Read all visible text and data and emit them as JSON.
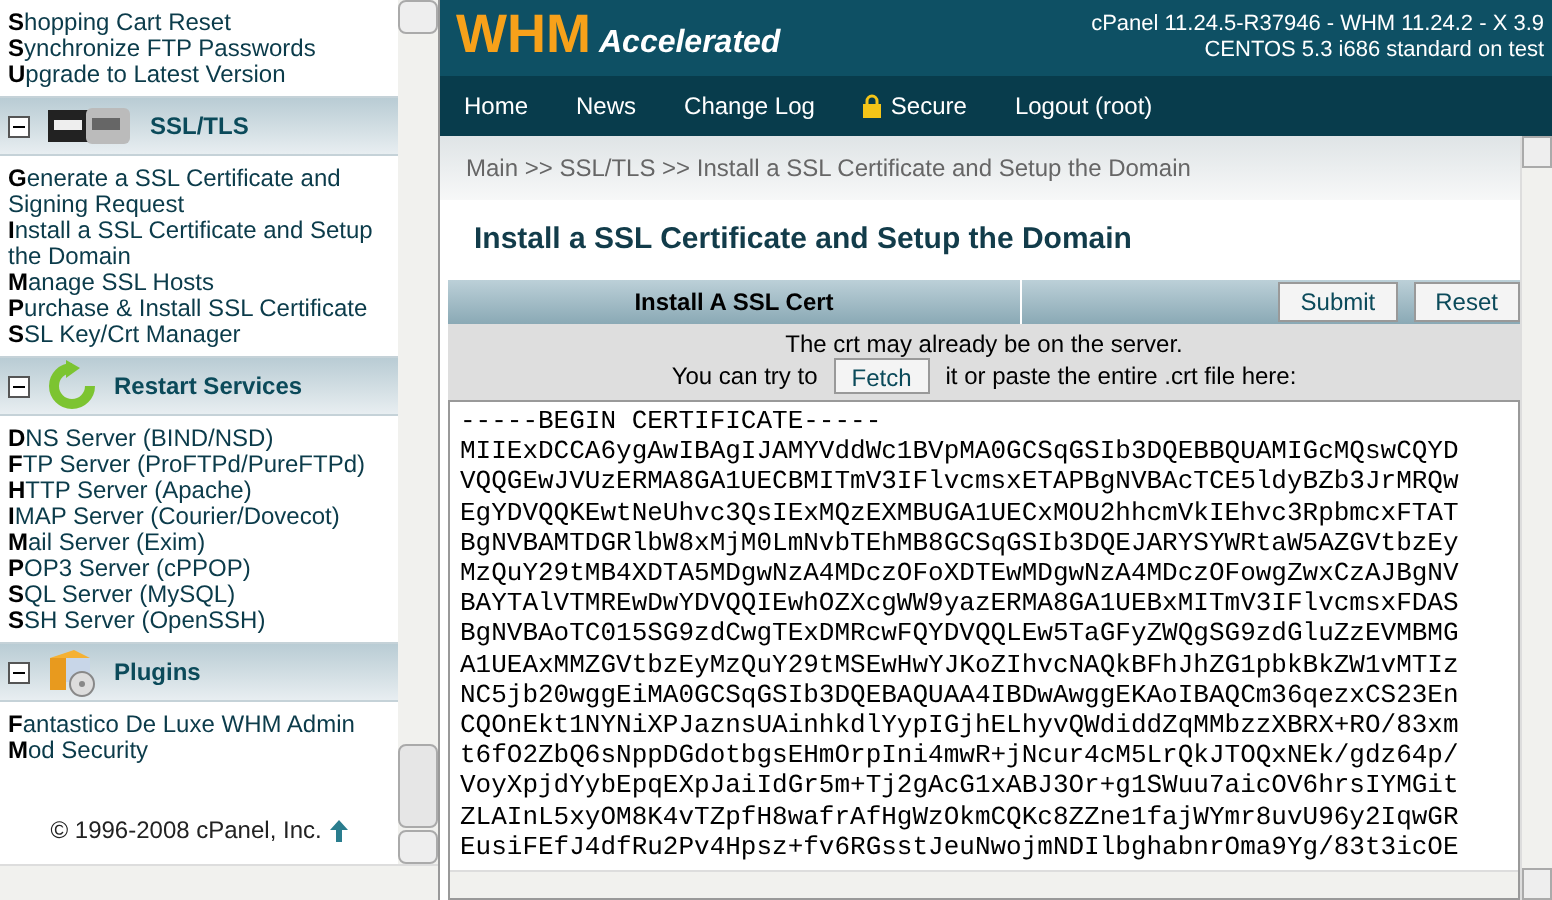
{
  "sidebar": {
    "groups": [
      {
        "items": [
          "**S**hopping Cart Reset",
          "**S**ynchronize FTP Passwords",
          "**U**pgrade to Latest Version"
        ]
      },
      {
        "title": "SSL/TLS",
        "kind": "modssl",
        "expanded": true,
        "items": [
          "**G**enerate a SSL Certificate and Signing Request",
          "**I**nstall a SSL Certificate and Setup the Domain",
          "**M**anage SSL Hosts",
          "**P**urchase & Install SSL Certificate",
          "**S**SL Key/Crt Manager"
        ]
      },
      {
        "title": "Restart Services",
        "kind": "restart",
        "expanded": true,
        "items": [
          "**D**NS Server (BIND/NSD)",
          "**F**TP Server (ProFTPd/PureFTPd)",
          "**H**TTP Server (Apache)",
          "**I**MAP Server (Courier/Dovecot)",
          "**M**ail Server (Exim)",
          "**P**OP3 Server (cPPOP)",
          "**S**QL Server (MySQL)",
          "**S**SH Server (OpenSSH)"
        ]
      },
      {
        "title": "Plugins",
        "kind": "plugins",
        "expanded": true,
        "items": [
          "**F**antastico De Luxe WHM Admin",
          "**M**od Security"
        ]
      }
    ],
    "footer": "© 1996-2008 cPanel, Inc."
  },
  "header": {
    "logo_main": "WHM",
    "logo_sub": "Accelerated",
    "version_line": "cPanel 11.24.5-R37946 - WHM 11.24.2 - X 3.9",
    "os_line": "CENTOS 5.3 i686 standard on test"
  },
  "nav": [
    {
      "label": "Home"
    },
    {
      "label": "News"
    },
    {
      "label": "Change Log"
    },
    {
      "label": "Secure",
      "kind": "secure"
    },
    {
      "label": "Logout (root)"
    }
  ],
  "breadcrumb": "Main >> SSL/TLS >> Install a SSL Certificate and Setup the Domain",
  "page_title": "Install a SSL Certificate and Setup the Domain",
  "form": {
    "heading": "Install A SSL Cert",
    "buttons": [
      "Submit",
      "Reset"
    ],
    "note": "The crt may already be on the server.",
    "fetch_prefix": "You can try to",
    "fetch_button": "Fetch",
    "fetch_suffix": "it or paste the entire .crt file here:",
    "certificate": [
      "-----BEGIN CERTIFICATE-----",
      "MIIExDCCA6ygAwIBAgIJAMYVddWc1BVpMA0GCSqGSIb3DQEBBQUAMIGcMQswCQYD",
      "VQQGEwJVUzERMA8GA1UECBMITmV3IFlvcmsxETAPBgNVBAcTCE5ldyBZb3JrMRQw",
      "EgYDVQQKEwtNeUhvc3QsIExMQzEXMBUGA1UECxMOU2hhcmVkIEhvc3RpbmcxFTAT",
      "BgNVBAMTDGRlbW8xMjM0LmNvbTEhMB8GCSqGSIb3DQEJARYSYWRtaW5AZGVtbzEy",
      "MzQuY29tMB4XDTA5MDgwNzA4MDczOFoXDTEwMDgwNzA4MDczOFowgZwxCzAJBgNV",
      "BAYTAlVTMREwDwYDVQQIEwhOZXcgWW9yazERMA8GA1UEBxMITmV3IFlvcmsxFDAS",
      "BgNVBAoTC015SG9zdCwgTExDMRcwFQYDVQQLEw5TaGFyZWQgSG9zdGluZzEVMBMG",
      "A1UEAxMMZGVtbzEyMzQuY29tMSEwHwYJKoZIhvcNAQkBFhJhZG1pbkBkZW1vMTIz",
      "NC5jb20wggEiMA0GCSqGSIb3DQEBAQUAA4IBDwAwggEKAoIBAQCm36qezxCS23En",
      "CQOnEkt1NYNiXPJaznsUAinhkdlYypIGjhELhyvQWdiddZqMMbzzXBRX+RO/83xm",
      "t6fO2ZbQ6sNppDGdotbgsEHmOrpIni4mwR+jNcur4cM5LrQkJTOQxNEk/gdz64p/",
      "VoyXpjdYybEpqEXpJaiIdGr5m+Tj2gAcG1xABJ3Or+g1SWuu7aicOV6hrsIYMGit",
      "ZLAInL5xyOM8K4vTZpfH8wafrAfHgWzOkmCQKc8ZZne1fajWYmr8uvU96y2IqwGR",
      "EusiFEfJ4dfRu2Pv4Hpsz+fv6RGsstJeuNwojmNDIlbghabnrOma9Yg/83t3icOE"
    ]
  }
}
